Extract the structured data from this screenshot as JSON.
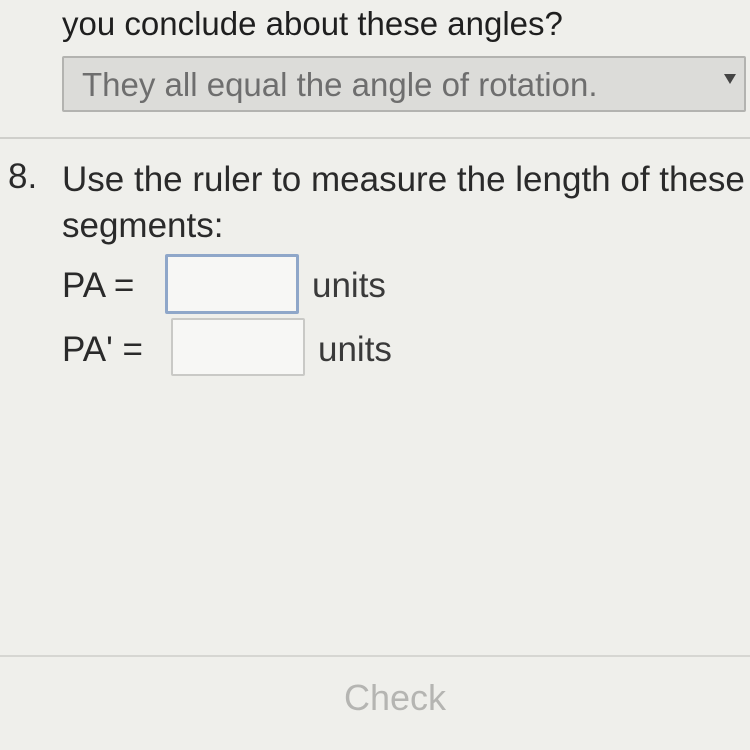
{
  "previous_question": {
    "text_tail": "you conclude about these angles?",
    "dropdown_selected": "They all equal the angle of rotation."
  },
  "question": {
    "number": "8.",
    "text": "Use the ruler to measure the length of these segments:"
  },
  "answers": [
    {
      "label": "PA =",
      "value": "",
      "unit": "units"
    },
    {
      "label": "PA' =",
      "value": "",
      "unit": "units"
    }
  ],
  "footer": {
    "check_label": "Check"
  },
  "icons": {
    "dropdown_arrow": "chevron-down-icon"
  },
  "colors": {
    "background": "#efefeb",
    "focus_border": "#8fa7c9",
    "disabled_text": "#b5b5b2"
  }
}
